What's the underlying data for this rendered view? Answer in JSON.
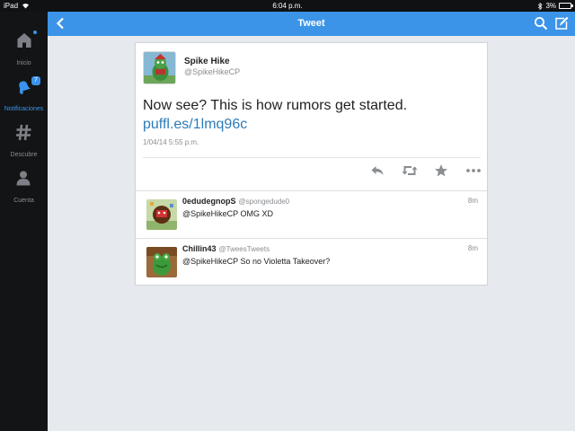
{
  "status_bar": {
    "device": "iPad",
    "time": "6:04 p.m.",
    "battery": "3%"
  },
  "sidebar": {
    "items": [
      {
        "label": "Inicio",
        "icon": "home-icon",
        "active": false
      },
      {
        "label": "Notificaciones",
        "icon": "bell-icon",
        "active": true,
        "badge": "7"
      },
      {
        "label": "Descubre",
        "icon": "hashtag-icon",
        "active": false
      },
      {
        "label": "Cuenta",
        "icon": "person-icon",
        "active": false
      }
    ]
  },
  "nav": {
    "title": "Tweet"
  },
  "tweet": {
    "name": "Spike Hike",
    "handle": "@SpikeHikeCP",
    "text": "Now see? This is how rumors get started. ",
    "link": "puffl.es/1lmq96c",
    "timestamp": "1/04/14 5:55 p.m."
  },
  "replies": [
    {
      "name": "0edudegnopS",
      "handle": "@spongedude0",
      "text": "@SpikeHikeCP OMG XD",
      "time": "8m"
    },
    {
      "name": "Chillin43",
      "handle": "@TweesTweets",
      "text": "@SpikeHikeCP So no Violetta Takeover?",
      "time": "8m"
    }
  ],
  "colors": {
    "accent": "#3b94e8",
    "sidebar": "#131415",
    "background": "#e6e9ee",
    "link": "#2b7bb9"
  }
}
